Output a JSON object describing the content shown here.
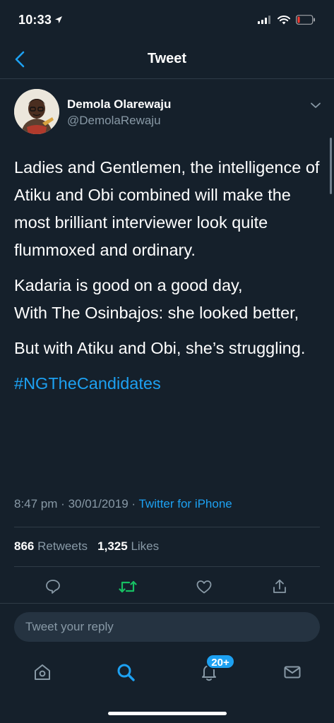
{
  "status_bar": {
    "time": "10:33"
  },
  "nav": {
    "title": "Tweet"
  },
  "author": {
    "name": "Demola Olarewaju",
    "handle": "@DemolaRewaju"
  },
  "tweet": {
    "paragraphs": [
      "Ladies and Gentlemen, the intelligence of Atiku and Obi combined will make the most brilliant interviewer look quite flummoxed and ordinary.",
      "Kadaria is good on a good day,\nWith The Osinbajos: she looked better,",
      "But with Atiku and Obi, she’s struggling."
    ],
    "hashtag": "#NGTheCandidates"
  },
  "meta": {
    "time": "8:47 pm",
    "date": "30/01/2019",
    "source": "Twitter for iPhone"
  },
  "stats": {
    "retweets_count": "866",
    "retweets_label": "Retweets",
    "likes_count": "1,325",
    "likes_label": "Likes"
  },
  "reply": {
    "placeholder": "Tweet your reply"
  },
  "tab_bar": {
    "notifications_badge": "20+"
  },
  "colors": {
    "background": "#15202b",
    "accent": "#1da1f2",
    "retweet_green": "#17bf63",
    "secondary_text": "#8899a6"
  }
}
